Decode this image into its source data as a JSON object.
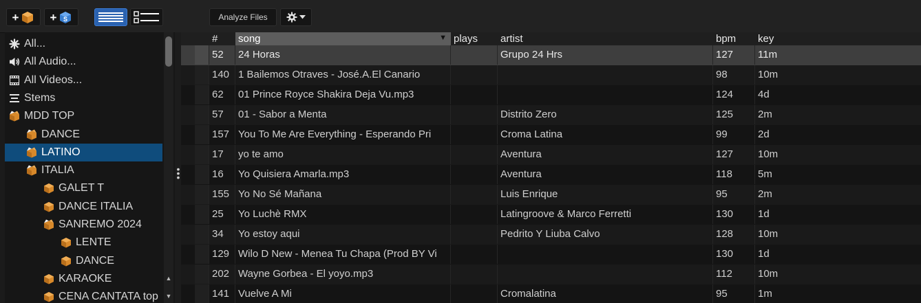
{
  "toolbar": {
    "analyze_label": "Analyze Files",
    "add_folder_plus": "+",
    "add_stem_plus": "+",
    "add_stem_badge": "S"
  },
  "sidebar": {
    "items": [
      {
        "label": "All...",
        "icon": "asterisk-icon",
        "indent": 0,
        "selected": false
      },
      {
        "label": "All Audio...",
        "icon": "speaker-icon",
        "indent": 0,
        "selected": false
      },
      {
        "label": "All Videos...",
        "icon": "film-icon",
        "indent": 0,
        "selected": false
      },
      {
        "label": "Stems",
        "icon": "stems-icon",
        "indent": 0,
        "selected": false
      },
      {
        "label": "MDD TOP",
        "icon": "folder-open-icon",
        "indent": 0,
        "selected": false
      },
      {
        "label": "DANCE",
        "icon": "folder-open-icon",
        "indent": 1,
        "selected": false
      },
      {
        "label": "LATINO",
        "icon": "folder-open-icon",
        "indent": 1,
        "selected": true
      },
      {
        "label": "ITALIA",
        "icon": "folder-open-icon",
        "indent": 1,
        "selected": false
      },
      {
        "label": "GALET T",
        "icon": "folder-icon",
        "indent": 2,
        "selected": false
      },
      {
        "label": "DANCE ITALIA",
        "icon": "folder-icon",
        "indent": 2,
        "selected": false
      },
      {
        "label": "SANREMO 2024",
        "icon": "folder-open-icon",
        "indent": 2,
        "selected": false
      },
      {
        "label": "LENTE",
        "icon": "folder-icon",
        "indent": 3,
        "selected": false
      },
      {
        "label": "DANCE",
        "icon": "folder-icon",
        "indent": 3,
        "selected": false
      },
      {
        "label": "KARAOKE",
        "icon": "folder-icon",
        "indent": 2,
        "selected": false
      },
      {
        "label": "CENA CANTATA top",
        "icon": "folder-icon",
        "indent": 2,
        "selected": false
      }
    ]
  },
  "table": {
    "columns": {
      "num": "#",
      "song": "song",
      "plays": "plays",
      "artist": "artist",
      "bpm": "bpm",
      "key": "key"
    },
    "sorted_column": "song",
    "rows": [
      {
        "num": "52",
        "song": "24 Horas",
        "plays": "",
        "artist": "Grupo 24 Hrs",
        "bpm": "127",
        "key": "11m",
        "active": true
      },
      {
        "num": "140",
        "song": "1 Bailemos Otraves - José.A.El Canario",
        "plays": "",
        "artist": "",
        "bpm": "98",
        "key": "10m",
        "active": false
      },
      {
        "num": "62",
        "song": "01 Prince Royce Shakira Deja Vu.mp3",
        "plays": "",
        "artist": "",
        "bpm": "124",
        "key": "4d",
        "active": false
      },
      {
        "num": "57",
        "song": "01 - Sabor a Menta",
        "plays": "",
        "artist": "Distrito Zero",
        "bpm": "125",
        "key": "2m",
        "active": false
      },
      {
        "num": "157",
        "song": "You To Me Are Everything - Esperando Pri",
        "plays": "",
        "artist": "Croma Latina",
        "bpm": "99",
        "key": "2d",
        "active": false
      },
      {
        "num": "17",
        "song": "yo te amo",
        "plays": "",
        "artist": "Aventura",
        "bpm": "127",
        "key": "10m",
        "active": false
      },
      {
        "num": "16",
        "song": "Yo Quisiera Amarla.mp3",
        "plays": "",
        "artist": "Aventura",
        "bpm": "118",
        "key": "5m",
        "active": false
      },
      {
        "num": "155",
        "song": "Yo No Sé Mañana",
        "plays": "",
        "artist": "Luis Enrique",
        "bpm": "95",
        "key": "2m",
        "active": false
      },
      {
        "num": "25",
        "song": "Yo Luchè RMX",
        "plays": "",
        "artist": "Latingroove & Marco Ferretti",
        "bpm": "130",
        "key": "1d",
        "active": false
      },
      {
        "num": "34",
        "song": "Yo estoy aqui",
        "plays": "",
        "artist": "Pedrito Y Liuba Calvo",
        "bpm": "128",
        "key": "10m",
        "active": false
      },
      {
        "num": "129",
        "song": "Wilo D New - Menea Tu Chapa (Prod BY Vi",
        "plays": "",
        "artist": "",
        "bpm": "130",
        "key": "1d",
        "active": false
      },
      {
        "num": "202",
        "song": "Wayne Gorbea - El yoyo.mp3",
        "plays": "",
        "artist": "",
        "bpm": "112",
        "key": "10m",
        "active": false
      },
      {
        "num": "141",
        "song": "Vuelve A Mi",
        "plays": "",
        "artist": "Cromalatina",
        "bpm": "95",
        "key": "1m",
        "active": false
      }
    ]
  },
  "colors": {
    "accent": "#0f4c7c",
    "folder": "#d8892a",
    "view_active": "#2a62b0"
  }
}
